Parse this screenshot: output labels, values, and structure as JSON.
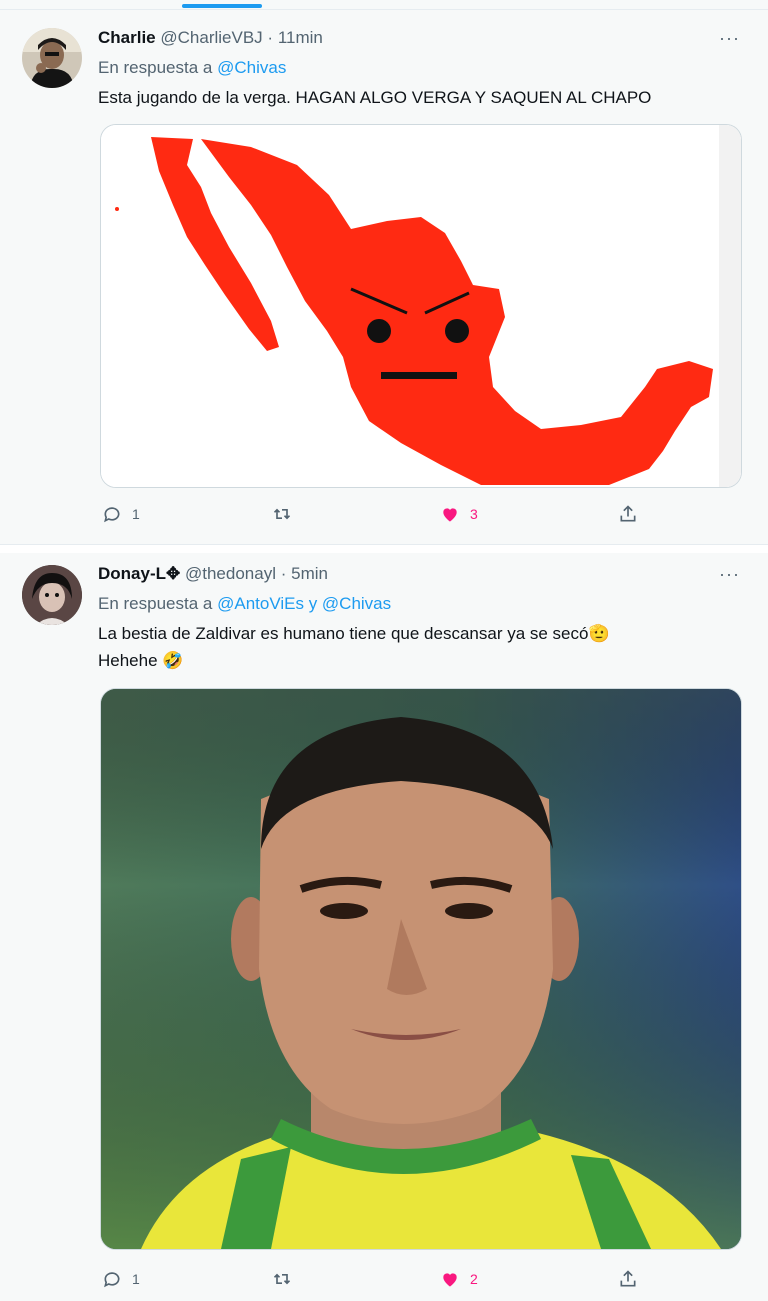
{
  "tweets": [
    {
      "author_name": "Charlie",
      "handle": "@CharlieVBJ",
      "separator": "·",
      "time": "11min",
      "reply_prefix": "En respuesta a",
      "reply_mentions": "@Chivas",
      "text": "Esta jugando de la verga. HAGAN ALGO VERGA Y SAQUEN AL CHAPO",
      "media_description": "map-of-mexico-angry-face",
      "replies": "1",
      "retweets": "",
      "likes": "3",
      "liked": true
    },
    {
      "author_name": "Donay-L✥",
      "handle": "@thedonayl",
      "separator": "·",
      "time": "5min",
      "reply_prefix": "En respuesta a",
      "reply_mentions": "@AntoViEs y @Chivas",
      "text_line1": "La bestia de Zaldivar es humano tiene que descansar ya se secó🫡",
      "text_line2": "Hehehe 🤣",
      "media_description": "portrait-soccer-player",
      "replies": "1",
      "retweets": "",
      "likes": "2",
      "liked": true
    }
  ],
  "more_icon": "···",
  "colors": {
    "accent": "#1d9bf0",
    "like": "#f91880",
    "map_red": "#ff2a12",
    "muted": "#536471"
  }
}
